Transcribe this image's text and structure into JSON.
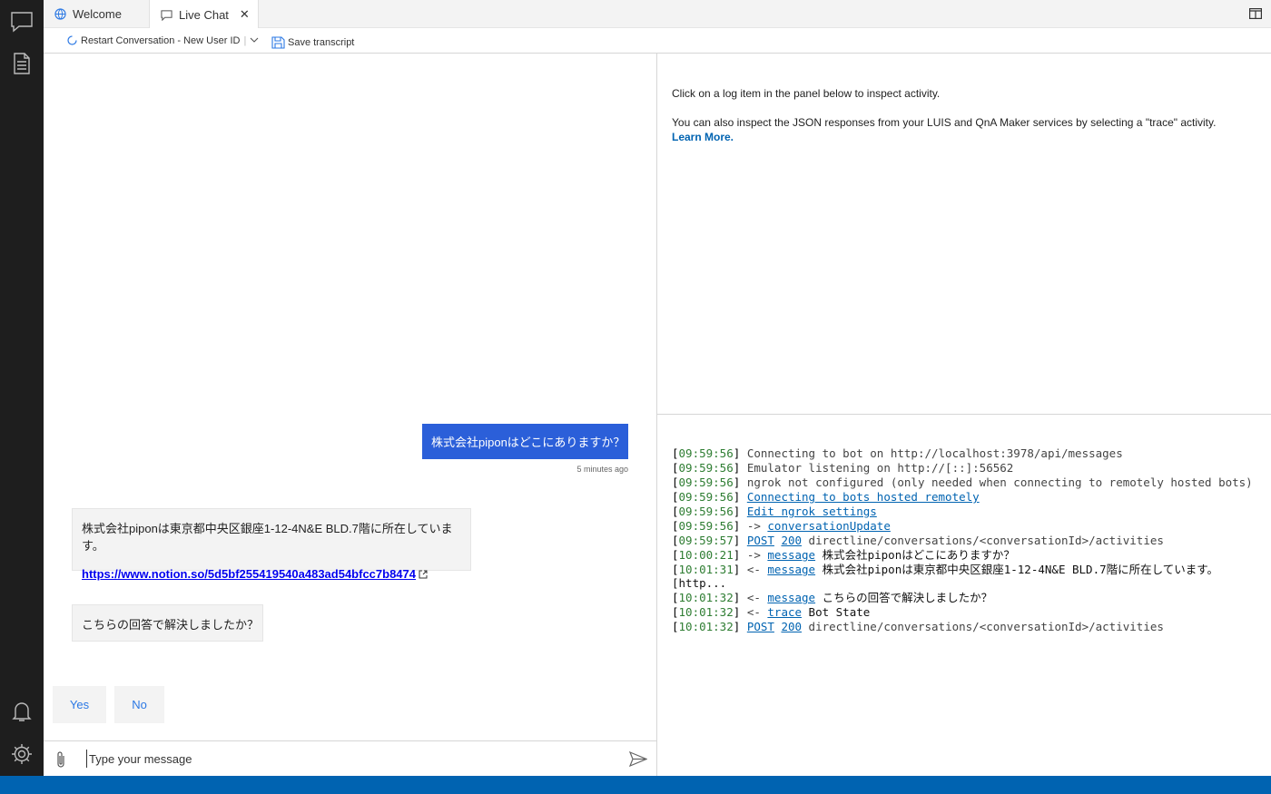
{
  "tabs": [
    {
      "label": "Welcome",
      "icon": "globe-icon",
      "active": false
    },
    {
      "label": "Live Chat",
      "icon": "chat-bubble-icon",
      "active": true
    }
  ],
  "toolbar": {
    "restart_label": "Restart Conversation - New User ID",
    "save_label": "Save transcript"
  },
  "chat": {
    "user_message": "株式会社piponはどこにありますか？",
    "user_timestamp": "5 minutes ago",
    "bot_message_1_text": "株式会社piponは東京都中央区銀座1-12-4N&E BLD.7階に所在しています。",
    "bot_message_1_link": "https://www.notion.so/5d5bf255419540a483ad54bfcc7b8474",
    "bot_message_2": "こちらの回答で解決しましたか？",
    "suggested_actions": [
      "Yes",
      "No"
    ],
    "input_placeholder": "Type your message"
  },
  "inspector": {
    "line1": "Click on a log item in the panel below to inspect activity.",
    "line2": "You can also inspect the JSON responses from your LUIS and QnA Maker services by selecting a \"trace\" activity.",
    "learn_more": "Learn More."
  },
  "log": [
    {
      "time": "09:59:56",
      "parts": [
        {
          "t": "text",
          "v": "Connecting to bot on http://localhost:3978/api/messages"
        }
      ]
    },
    {
      "time": "09:59:56",
      "parts": [
        {
          "t": "text",
          "v": "Emulator listening on http://[::]:56562"
        }
      ]
    },
    {
      "time": "09:59:56",
      "parts": [
        {
          "t": "text",
          "v": "ngrok not configured (only needed when connecting to remotely hosted bots)"
        }
      ]
    },
    {
      "time": "09:59:56",
      "parts": [
        {
          "t": "link",
          "v": "Connecting to bots hosted remotely"
        }
      ]
    },
    {
      "time": "09:59:56",
      "parts": [
        {
          "t": "link",
          "v": "Edit ngrok settings"
        }
      ]
    },
    {
      "time": "09:59:56",
      "parts": [
        {
          "t": "text",
          "v": "-> "
        },
        {
          "t": "link",
          "v": "conversationUpdate"
        }
      ]
    },
    {
      "time": "09:59:57",
      "parts": [
        {
          "t": "link",
          "v": "POST"
        },
        {
          "t": "text",
          "v": " "
        },
        {
          "t": "link",
          "v": "200"
        },
        {
          "t": "text",
          "v": " directline/conversations/<conversationId>/activities"
        }
      ]
    },
    {
      "time": "10:00:21",
      "parts": [
        {
          "t": "text",
          "v": "-> "
        },
        {
          "t": "link",
          "v": "message"
        },
        {
          "t": "dark",
          "v": " 株式会社piponはどこにありますか？"
        }
      ]
    },
    {
      "time": "10:01:31",
      "parts": [
        {
          "t": "text",
          "v": "<- "
        },
        {
          "t": "link",
          "v": "message"
        },
        {
          "t": "dark",
          "v": " 株式会社piponは東京都中央区銀座1-12-4N&E BLD.7階に所在しています。[http..."
        }
      ]
    },
    {
      "time": "10:01:32",
      "parts": [
        {
          "t": "text",
          "v": "<- "
        },
        {
          "t": "link",
          "v": "message"
        },
        {
          "t": "dark",
          "v": " こちらの回答で解決しましたか？"
        }
      ]
    },
    {
      "time": "10:01:32",
      "parts": [
        {
          "t": "text",
          "v": "<- "
        },
        {
          "t": "link",
          "v": "trace"
        },
        {
          "t": "dark",
          "v": " Bot State"
        }
      ]
    },
    {
      "time": "10:01:32",
      "parts": [
        {
          "t": "link",
          "v": "POST"
        },
        {
          "t": "text",
          "v": " "
        },
        {
          "t": "link",
          "v": "200"
        },
        {
          "t": "text",
          "v": " directline/conversations/<conversationId>/activities"
        }
      ]
    }
  ],
  "colors": {
    "sidebar": "#1e1e1e",
    "statusbar": "#0063b1",
    "user_bubble": "#2b5fd9",
    "link": "#0063b1",
    "timestamp": "#2e7d32"
  }
}
